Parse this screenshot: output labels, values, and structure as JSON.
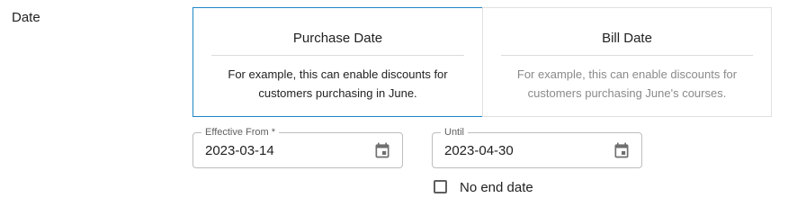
{
  "section": {
    "label": "Date"
  },
  "cards": [
    {
      "title": "Purchase Date",
      "description": "For example, this can enable discounts for customers purchasing in June.",
      "selected": true
    },
    {
      "title": "Bill Date",
      "description": "For example, this can enable discounts for customers purchasing June's courses.",
      "selected": false
    }
  ],
  "fields": {
    "effective_from": {
      "label": "Effective From *",
      "value": "2023-03-14",
      "icon": "calendar-icon"
    },
    "until": {
      "label": "Until",
      "value": "2023-04-30",
      "icon": "calendar-icon"
    }
  },
  "no_end_date": {
    "label": "No end date",
    "checked": false
  },
  "colors": {
    "selected_border": "#1e88c8",
    "muted_text": "#8a8a8a",
    "icon_gray": "#6f6f6f"
  }
}
